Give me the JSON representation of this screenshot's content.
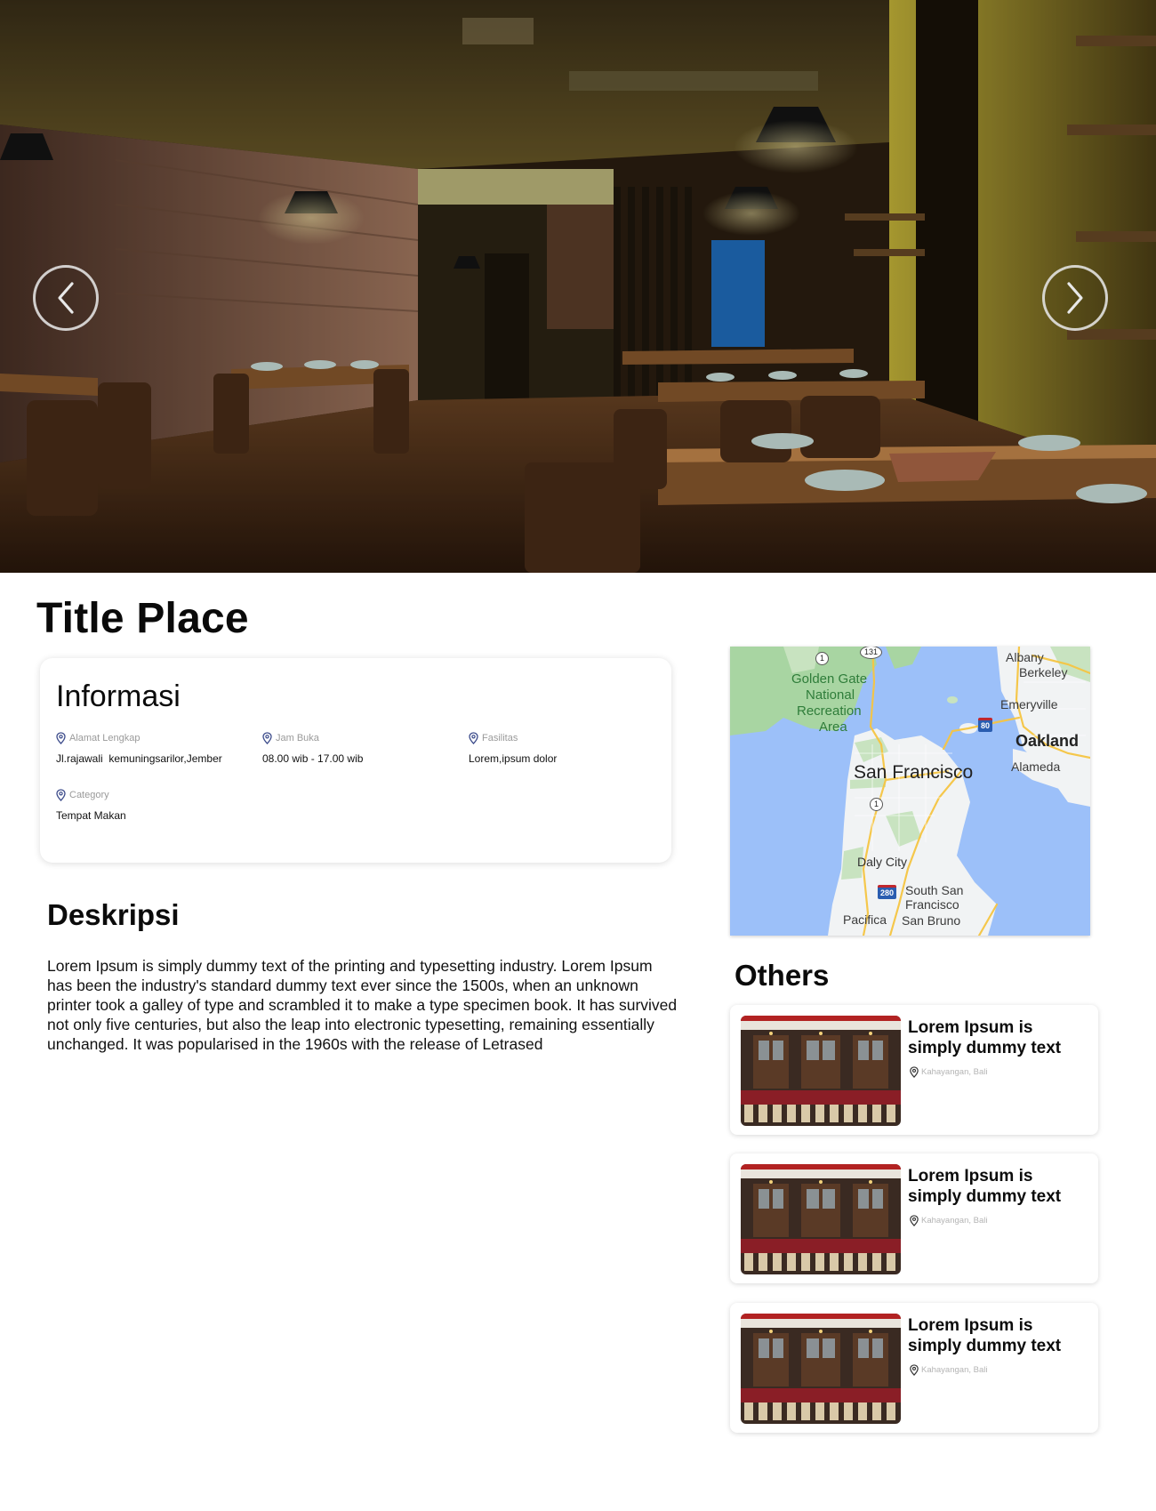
{
  "hero": {
    "prev_icon": "chevron-left-icon",
    "next_icon": "chevron-right-icon"
  },
  "page_title": "Title Place",
  "informasi": {
    "title": "Informasi",
    "items": [
      {
        "label": "Alamat Lengkap",
        "value": "Jl.rajawali  kemuningsarilor,Jember",
        "icon": "location-pin-icon"
      },
      {
        "label": "Jam Buka",
        "value": "08.00 wib - 17.00 wib",
        "icon": "location-pin-icon"
      },
      {
        "label": "Fasilitas",
        "value": "Lorem,ipsum dolor",
        "icon": "location-pin-icon"
      },
      {
        "label": "Category",
        "value": "Tempat Makan",
        "icon": "location-pin-icon"
      }
    ]
  },
  "deskripsi": {
    "title": "Deskripsi",
    "text": "Lorem Ipsum is simply dummy text of the printing and typesetting industry. Lorem Ipsum has been the industry's standard dummy text ever since the 1500s, when an unknown printer took a galley of type and scrambled it to make a type specimen book. It has survived not only five centuries, but also the leap into electronic typesetting, remaining essentially unchanged. It was popularised in the 1960s with the release of Letrased"
  },
  "map": {
    "labels": {
      "albany": "Albany",
      "berkeley": "Berkeley",
      "emeryville": "Emeryville",
      "oakland": "Oakland",
      "alameda": "Alameda",
      "golden_gate": "Golden Gate",
      "national": "National",
      "recreation": "Recreation",
      "area": "Area",
      "san_francisco": "San Francisco",
      "daly_city": "Daly City",
      "south_san": "South San",
      "francisco": "Francisco",
      "pacifica": "Pacifica",
      "san_bruno": "San Bruno"
    },
    "shields": {
      "r131": "131",
      "r1_north": "1",
      "r1_south": "1",
      "i80": "80",
      "i280": "280"
    }
  },
  "others": {
    "title": "Others",
    "items": [
      {
        "title": "Lorem Ipsum is simply dummy text",
        "location": "Kahayangan, Bali"
      },
      {
        "title": "Lorem Ipsum is simply dummy text",
        "location": "Kahayangan, Bali"
      },
      {
        "title": "Lorem Ipsum is simply dummy text",
        "location": "Kahayangan, Bali"
      }
    ]
  },
  "colors": {
    "accent_icon": "#3b4a8a",
    "muted_text": "#9a9a9a",
    "map_water": "#9cc0f9",
    "map_land": "#f1f3f4",
    "map_park": "#a8d5a2",
    "map_road": "#f6c542"
  }
}
